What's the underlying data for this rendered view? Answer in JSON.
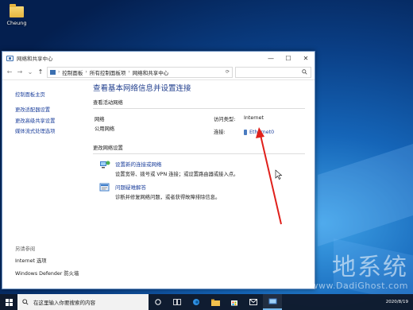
{
  "desktop": {
    "icon_label": "Cheung"
  },
  "window": {
    "title": "网络和共享中心",
    "controls": {
      "minimize": "—",
      "maximize": "☐",
      "close": "✕"
    }
  },
  "address_bar": {
    "crumbs": [
      "控制面板",
      "所有控制面板项",
      "网络和共享中心"
    ],
    "separator": "›"
  },
  "sidebar": {
    "links": [
      "控制面板主页",
      "更改适配器设置",
      "更改高级共享设置",
      "媒体流式处理选项"
    ],
    "see_also_heading": "另请参阅",
    "see_also_links": [
      "Internet 选项",
      "Windows Defender 防火墙"
    ]
  },
  "main": {
    "page_title": "查看基本网络信息并设置连接",
    "active_networks_label": "查看活动网络",
    "network_name": "网络",
    "network_type": "公用网络",
    "access_type_label": "访问类型:",
    "access_type_value": "Internet",
    "connections_label": "连接:",
    "connection_value": "Ethernet0",
    "change_settings_label": "更改网络设置",
    "settings": [
      {
        "title": "设置新的连接或网络",
        "desc": "设置宽带、拨号或 VPN 连接；或设置路由器或接入点。",
        "icon": "new-connection-icon"
      },
      {
        "title": "问题疑难解答",
        "desc": "诊断并修复网络问题，或者获得故障排除信息。",
        "icon": "troubleshoot-icon"
      }
    ]
  },
  "taskbar": {
    "search_placeholder": "在这里输入你要搜索的内容",
    "tray_date": "2020/8/19"
  },
  "watermark": {
    "cn": "地系统",
    "en": "www.DadiGhost.com"
  },
  "colors": {
    "link": "#1a3e9b",
    "title": "#1e3c8c",
    "annotation": "#e0201b",
    "desktop": "#0a3f86"
  }
}
